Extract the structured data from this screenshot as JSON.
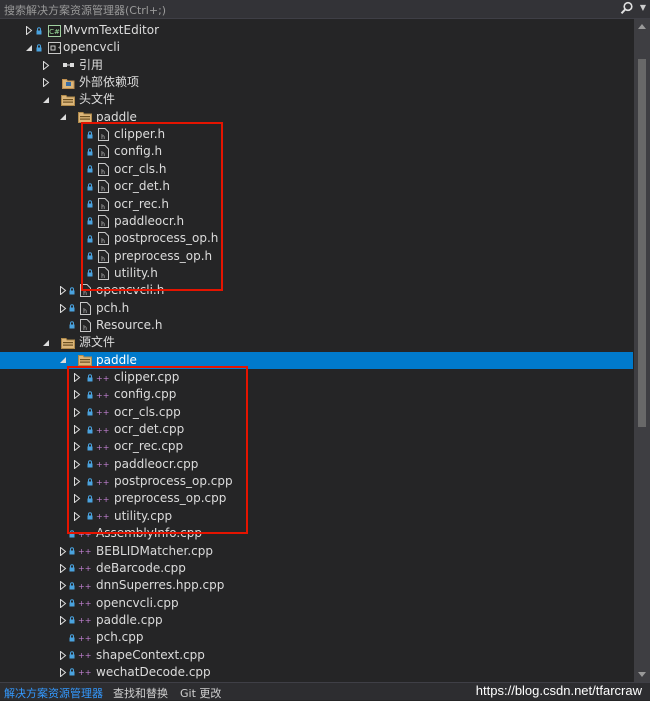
{
  "search": {
    "placeholder": "搜索解决方案资源管理器(Ctrl+;)"
  },
  "tree": {
    "rows": [
      {
        "label": "MvvmTextEditor",
        "level": 0,
        "expander": "collapsed",
        "icon": "csharp-project-icon",
        "lock": true
      },
      {
        "label": "opencvcli",
        "level": 0,
        "expander": "expanded",
        "icon": "cpp-project-icon",
        "lock": true
      },
      {
        "label": "引用",
        "level": 1,
        "expander": "collapsed",
        "icon": "references-icon",
        "lock": false
      },
      {
        "label": "外部依赖项",
        "level": 1,
        "expander": "collapsed",
        "icon": "external-deps-icon",
        "lock": false
      },
      {
        "label": "头文件",
        "level": 1,
        "expander": "expanded",
        "icon": "filter-folder-icon",
        "lock": false
      },
      {
        "label": "paddle",
        "level": 2,
        "expander": "expanded",
        "icon": "filter-folder-icon",
        "lock": false
      },
      {
        "label": "clipper.h",
        "level": 3,
        "expander": "none",
        "icon": "header-file-icon",
        "lock": true
      },
      {
        "label": "config.h",
        "level": 3,
        "expander": "none",
        "icon": "header-file-icon",
        "lock": true
      },
      {
        "label": "ocr_cls.h",
        "level": 3,
        "expander": "none",
        "icon": "header-file-icon",
        "lock": true
      },
      {
        "label": "ocr_det.h",
        "level": 3,
        "expander": "none",
        "icon": "header-file-icon",
        "lock": true
      },
      {
        "label": "ocr_rec.h",
        "level": 3,
        "expander": "none",
        "icon": "header-file-icon",
        "lock": true
      },
      {
        "label": "paddleocr.h",
        "level": 3,
        "expander": "none",
        "icon": "header-file-icon",
        "lock": true
      },
      {
        "label": "postprocess_op.h",
        "level": 3,
        "expander": "none",
        "icon": "header-file-icon",
        "lock": true
      },
      {
        "label": "preprocess_op.h",
        "level": 3,
        "expander": "none",
        "icon": "header-file-icon",
        "lock": true
      },
      {
        "label": "utility.h",
        "level": 3,
        "expander": "none",
        "icon": "header-file-icon",
        "lock": true
      },
      {
        "label": "opencvcli.h",
        "level": 2,
        "expander": "collapsed",
        "icon": "header-file-icon",
        "lock": true
      },
      {
        "label": "pch.h",
        "level": 2,
        "expander": "collapsed",
        "icon": "header-file-icon",
        "lock": true
      },
      {
        "label": "Resource.h",
        "level": 2,
        "expander": "none",
        "icon": "header-file-icon",
        "lock": true
      },
      {
        "label": "源文件",
        "level": 1,
        "expander": "expanded",
        "icon": "filter-folder-icon",
        "lock": false
      },
      {
        "label": "paddle",
        "level": 2,
        "expander": "expanded",
        "icon": "filter-folder-icon",
        "lock": false,
        "selected": true
      },
      {
        "label": "clipper.cpp",
        "level": 3,
        "expander": "collapsed",
        "icon": "cpp-file-icon",
        "lock": true
      },
      {
        "label": "config.cpp",
        "level": 3,
        "expander": "collapsed",
        "icon": "cpp-file-icon",
        "lock": true
      },
      {
        "label": "ocr_cls.cpp",
        "level": 3,
        "expander": "collapsed",
        "icon": "cpp-file-icon",
        "lock": true
      },
      {
        "label": "ocr_det.cpp",
        "level": 3,
        "expander": "collapsed",
        "icon": "cpp-file-icon",
        "lock": true
      },
      {
        "label": "ocr_rec.cpp",
        "level": 3,
        "expander": "collapsed",
        "icon": "cpp-file-icon",
        "lock": true
      },
      {
        "label": "paddleocr.cpp",
        "level": 3,
        "expander": "collapsed",
        "icon": "cpp-file-icon",
        "lock": true
      },
      {
        "label": "postprocess_op.cpp",
        "level": 3,
        "expander": "collapsed",
        "icon": "cpp-file-icon",
        "lock": true
      },
      {
        "label": "preprocess_op.cpp",
        "level": 3,
        "expander": "collapsed",
        "icon": "cpp-file-icon",
        "lock": true
      },
      {
        "label": "utility.cpp",
        "level": 3,
        "expander": "collapsed",
        "icon": "cpp-file-icon",
        "lock": true
      },
      {
        "label": "AssemblyInfo.cpp",
        "level": 2,
        "expander": "none",
        "icon": "cpp-file-icon",
        "lock": true
      },
      {
        "label": "BEBLIDMatcher.cpp",
        "level": 2,
        "expander": "collapsed",
        "icon": "cpp-file-icon",
        "lock": true
      },
      {
        "label": "deBarcode.cpp",
        "level": 2,
        "expander": "collapsed",
        "icon": "cpp-file-icon",
        "lock": true
      },
      {
        "label": "dnnSuperres.hpp.cpp",
        "level": 2,
        "expander": "collapsed",
        "icon": "cpp-file-icon",
        "lock": true
      },
      {
        "label": "opencvcli.cpp",
        "level": 2,
        "expander": "collapsed",
        "icon": "cpp-file-icon",
        "lock": true
      },
      {
        "label": "paddle.cpp",
        "level": 2,
        "expander": "collapsed",
        "icon": "cpp-file-icon",
        "lock": true
      },
      {
        "label": "pch.cpp",
        "level": 2,
        "expander": "none",
        "icon": "cpp-file-icon",
        "lock": true
      },
      {
        "label": "shapeContext.cpp",
        "level": 2,
        "expander": "collapsed",
        "icon": "cpp-file-icon",
        "lock": true
      },
      {
        "label": "wechatDecode.cpp",
        "level": 2,
        "expander": "collapsed",
        "icon": "cpp-file-icon",
        "lock": true
      }
    ]
  },
  "bottom_tabs": [
    {
      "label": "解决方案资源管理器",
      "active": true
    },
    {
      "label": "查找和替换",
      "active": false
    },
    {
      "label": "Git 更改",
      "active": false
    }
  ],
  "watermark": "https://blog.csdn.net/tfarcraw",
  "colors": {
    "background": "#252526",
    "selection": "#007acc",
    "highlight_box": "#e51400",
    "active_tab": "#3399ff"
  }
}
